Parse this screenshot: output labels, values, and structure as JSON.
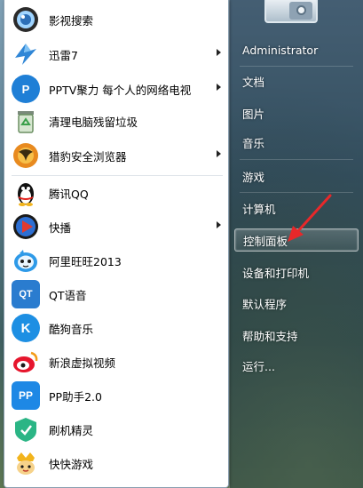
{
  "programs": [
    {
      "label": "影视搜索",
      "icon": "video-search-icon",
      "submenu": false
    },
    {
      "label": "迅雷7",
      "icon": "thunder-bird-icon",
      "submenu": true
    },
    {
      "label": "PPTV聚力 每个人的网络电视",
      "icon": "pptv-icon",
      "submenu": true
    },
    {
      "label": "清理电脑残留垃圾",
      "icon": "recycle-cleaner-icon",
      "submenu": false
    },
    {
      "label": "猎豹安全浏览器",
      "icon": "cheetah-browser-icon",
      "submenu": true
    },
    {
      "label": "腾讯QQ",
      "icon": "qq-penguin-icon",
      "submenu": false
    },
    {
      "label": "快播",
      "icon": "qvod-play-icon",
      "submenu": true
    },
    {
      "label": "阿里旺旺2013",
      "icon": "aliwangwang-icon",
      "submenu": false
    },
    {
      "label": "QT语音",
      "icon": "qt-voice-icon",
      "submenu": false
    },
    {
      "label": "酷狗音乐",
      "icon": "kugou-music-icon",
      "submenu": false
    },
    {
      "label": "新浪虚拟视频",
      "icon": "sina-weibo-icon",
      "submenu": false
    },
    {
      "label": "PP助手2.0",
      "icon": "pp-assistant-icon",
      "submenu": false
    },
    {
      "label": "刷机精灵",
      "icon": "flash-wizard-icon",
      "submenu": false
    },
    {
      "label": "快快游戏",
      "icon": "kuaikuai-game-icon",
      "submenu": false
    }
  ],
  "icon_text": {
    "pptv": "P",
    "qt": "QT",
    "kugou": "K",
    "pp": "PP"
  },
  "right_pane": {
    "user": "Administrator",
    "items": [
      "文档",
      "图片",
      "音乐",
      "游戏",
      "计算机",
      "控制面板",
      "设备和打印机",
      "默认程序",
      "帮助和支持",
      "运行..."
    ],
    "highlighted": "控制面板"
  },
  "colors": {
    "annotation_arrow": "#e8282a",
    "pptv_blue": "#1f7fd6",
    "qt_blue": "#2a7ccf",
    "kugou_blue": "#1d8fe3",
    "pp_blue": "#1e88e5"
  }
}
